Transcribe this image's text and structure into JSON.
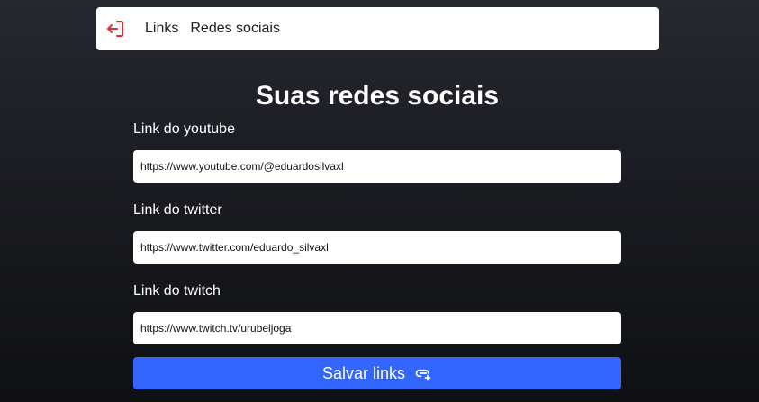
{
  "header": {
    "nav": [
      {
        "label": "Links"
      },
      {
        "label": "Redes sociais"
      }
    ],
    "logout_icon": "logout-icon"
  },
  "page": {
    "title": "Suas redes sociais"
  },
  "form": {
    "youtube": {
      "label": "Link do youtube",
      "value": "https://www.youtube.com/@eduardosilvaxl"
    },
    "twitter": {
      "label": "Link do twitter",
      "value": "https://www.twitter.com/eduardo_silvaxl"
    },
    "twitch": {
      "label": "Link do twitch",
      "value": "https://www.twitch.tv/urubeljoga"
    },
    "save_label": "Salvar links",
    "save_icon": "link-plus-icon"
  },
  "colors": {
    "accent": "#3366ff",
    "logout": "#e03131",
    "background": "#1b1c21"
  }
}
